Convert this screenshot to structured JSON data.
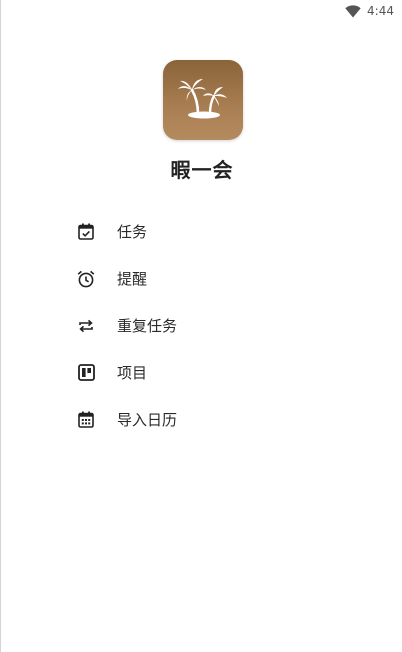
{
  "status_bar": {
    "time": "4:44",
    "icons": [
      "wifi-icon"
    ]
  },
  "app": {
    "name": "暇一会",
    "logo_icon": "palm-tree-icon",
    "logo_color": "#9b7246"
  },
  "menu": {
    "items": [
      {
        "label": "任务",
        "icon": "calendar-check-icon"
      },
      {
        "label": "提醒",
        "icon": "alarm-clock-icon"
      },
      {
        "label": "重复任务",
        "icon": "repeat-icon"
      },
      {
        "label": "项目",
        "icon": "board-icon"
      },
      {
        "label": "导入日历",
        "icon": "calendar-grid-icon"
      }
    ]
  }
}
